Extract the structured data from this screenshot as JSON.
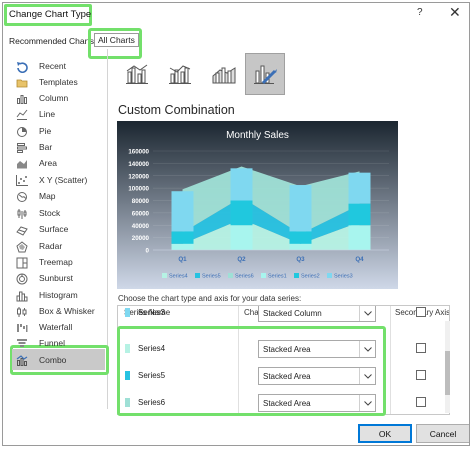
{
  "window": {
    "title": "Change Chart Type",
    "help": "?",
    "close": "✕"
  },
  "tabs": {
    "recommended": "Recommended Charts",
    "all": "All Charts"
  },
  "chart_types": [
    {
      "label": "Recent",
      "icon": "recent-icon"
    },
    {
      "label": "Templates",
      "icon": "folder-icon"
    },
    {
      "label": "Column",
      "icon": "column-chart-icon"
    },
    {
      "label": "Line",
      "icon": "line-chart-icon"
    },
    {
      "label": "Pie",
      "icon": "pie-chart-icon"
    },
    {
      "label": "Bar",
      "icon": "bar-chart-icon"
    },
    {
      "label": "Area",
      "icon": "area-chart-icon"
    },
    {
      "label": "X Y (Scatter)",
      "icon": "scatter-chart-icon"
    },
    {
      "label": "Map",
      "icon": "map-chart-icon"
    },
    {
      "label": "Stock",
      "icon": "stock-chart-icon"
    },
    {
      "label": "Surface",
      "icon": "surface-chart-icon"
    },
    {
      "label": "Radar",
      "icon": "radar-chart-icon"
    },
    {
      "label": "Treemap",
      "icon": "treemap-chart-icon"
    },
    {
      "label": "Sunburst",
      "icon": "sunburst-chart-icon"
    },
    {
      "label": "Histogram",
      "icon": "histogram-chart-icon"
    },
    {
      "label": "Box & Whisker",
      "icon": "box-whisker-chart-icon"
    },
    {
      "label": "Waterfall",
      "icon": "waterfall-chart-icon"
    },
    {
      "label": "Funnel",
      "icon": "funnel-chart-icon"
    },
    {
      "label": "Combo",
      "icon": "combo-chart-icon",
      "selected": true
    }
  ],
  "section_title": "Custom Combination",
  "chart_data": {
    "type": "area",
    "title": "Monthly Sales",
    "categories": [
      "Q1",
      "Q2",
      "Q3",
      "Q4"
    ],
    "ylim": [
      0,
      160000
    ],
    "yticks": [
      "0",
      "20000",
      "40000",
      "60000",
      "80000",
      "100000",
      "120000",
      "140000",
      "160000"
    ],
    "grid": true,
    "legend_position": "bottom",
    "area_series": [
      {
        "name": "Series4",
        "values": [
          10000,
          50000,
          10000,
          45000
        ],
        "color": "#b6f2e4"
      },
      {
        "name": "Series5",
        "values": [
          18000,
          35000,
          16000,
          28000
        ],
        "color": "#27c2e1"
      },
      {
        "name": "Series6",
        "values": [
          70000,
          50000,
          77000,
          54000
        ],
        "color": "#9fe0d6"
      }
    ],
    "column_series": [
      {
        "name": "Series1",
        "values": [
          10000,
          40000,
          10000,
          40000
        ],
        "color": "#a8f5ee"
      },
      {
        "name": "Series2",
        "values": [
          20000,
          40000,
          20000,
          35000
        ],
        "color": "#20c8de"
      },
      {
        "name": "Series3",
        "values": [
          65000,
          52000,
          75000,
          50000
        ],
        "color": "#7fd8f0"
      }
    ],
    "legend": [
      "Series4",
      "Series5",
      "Series6",
      "Series1",
      "Series2",
      "Series3"
    ]
  },
  "instruction": "Choose the chart type and axis for your data series:",
  "grid": {
    "headers": {
      "series": "Series Name",
      "type": "Chart Type",
      "axis": "Secondary Axis"
    },
    "rows": [
      {
        "name": "Series3",
        "type": "Stacked Column",
        "color": "#7fd8f0"
      },
      {
        "name": "Series4",
        "type": "Stacked Area",
        "color": "#b6f2e4"
      },
      {
        "name": "Series5",
        "type": "Stacked Area",
        "color": "#27c2e1"
      },
      {
        "name": "Series6",
        "type": "Stacked Area",
        "color": "#9fe0d6"
      }
    ]
  },
  "buttons": {
    "ok": "OK",
    "cancel": "Cancel"
  },
  "colors": {
    "highlight": "#73e06b",
    "chart_bg_top": "#1b2630",
    "chart_bg_bottom": "#cfd8e8"
  }
}
